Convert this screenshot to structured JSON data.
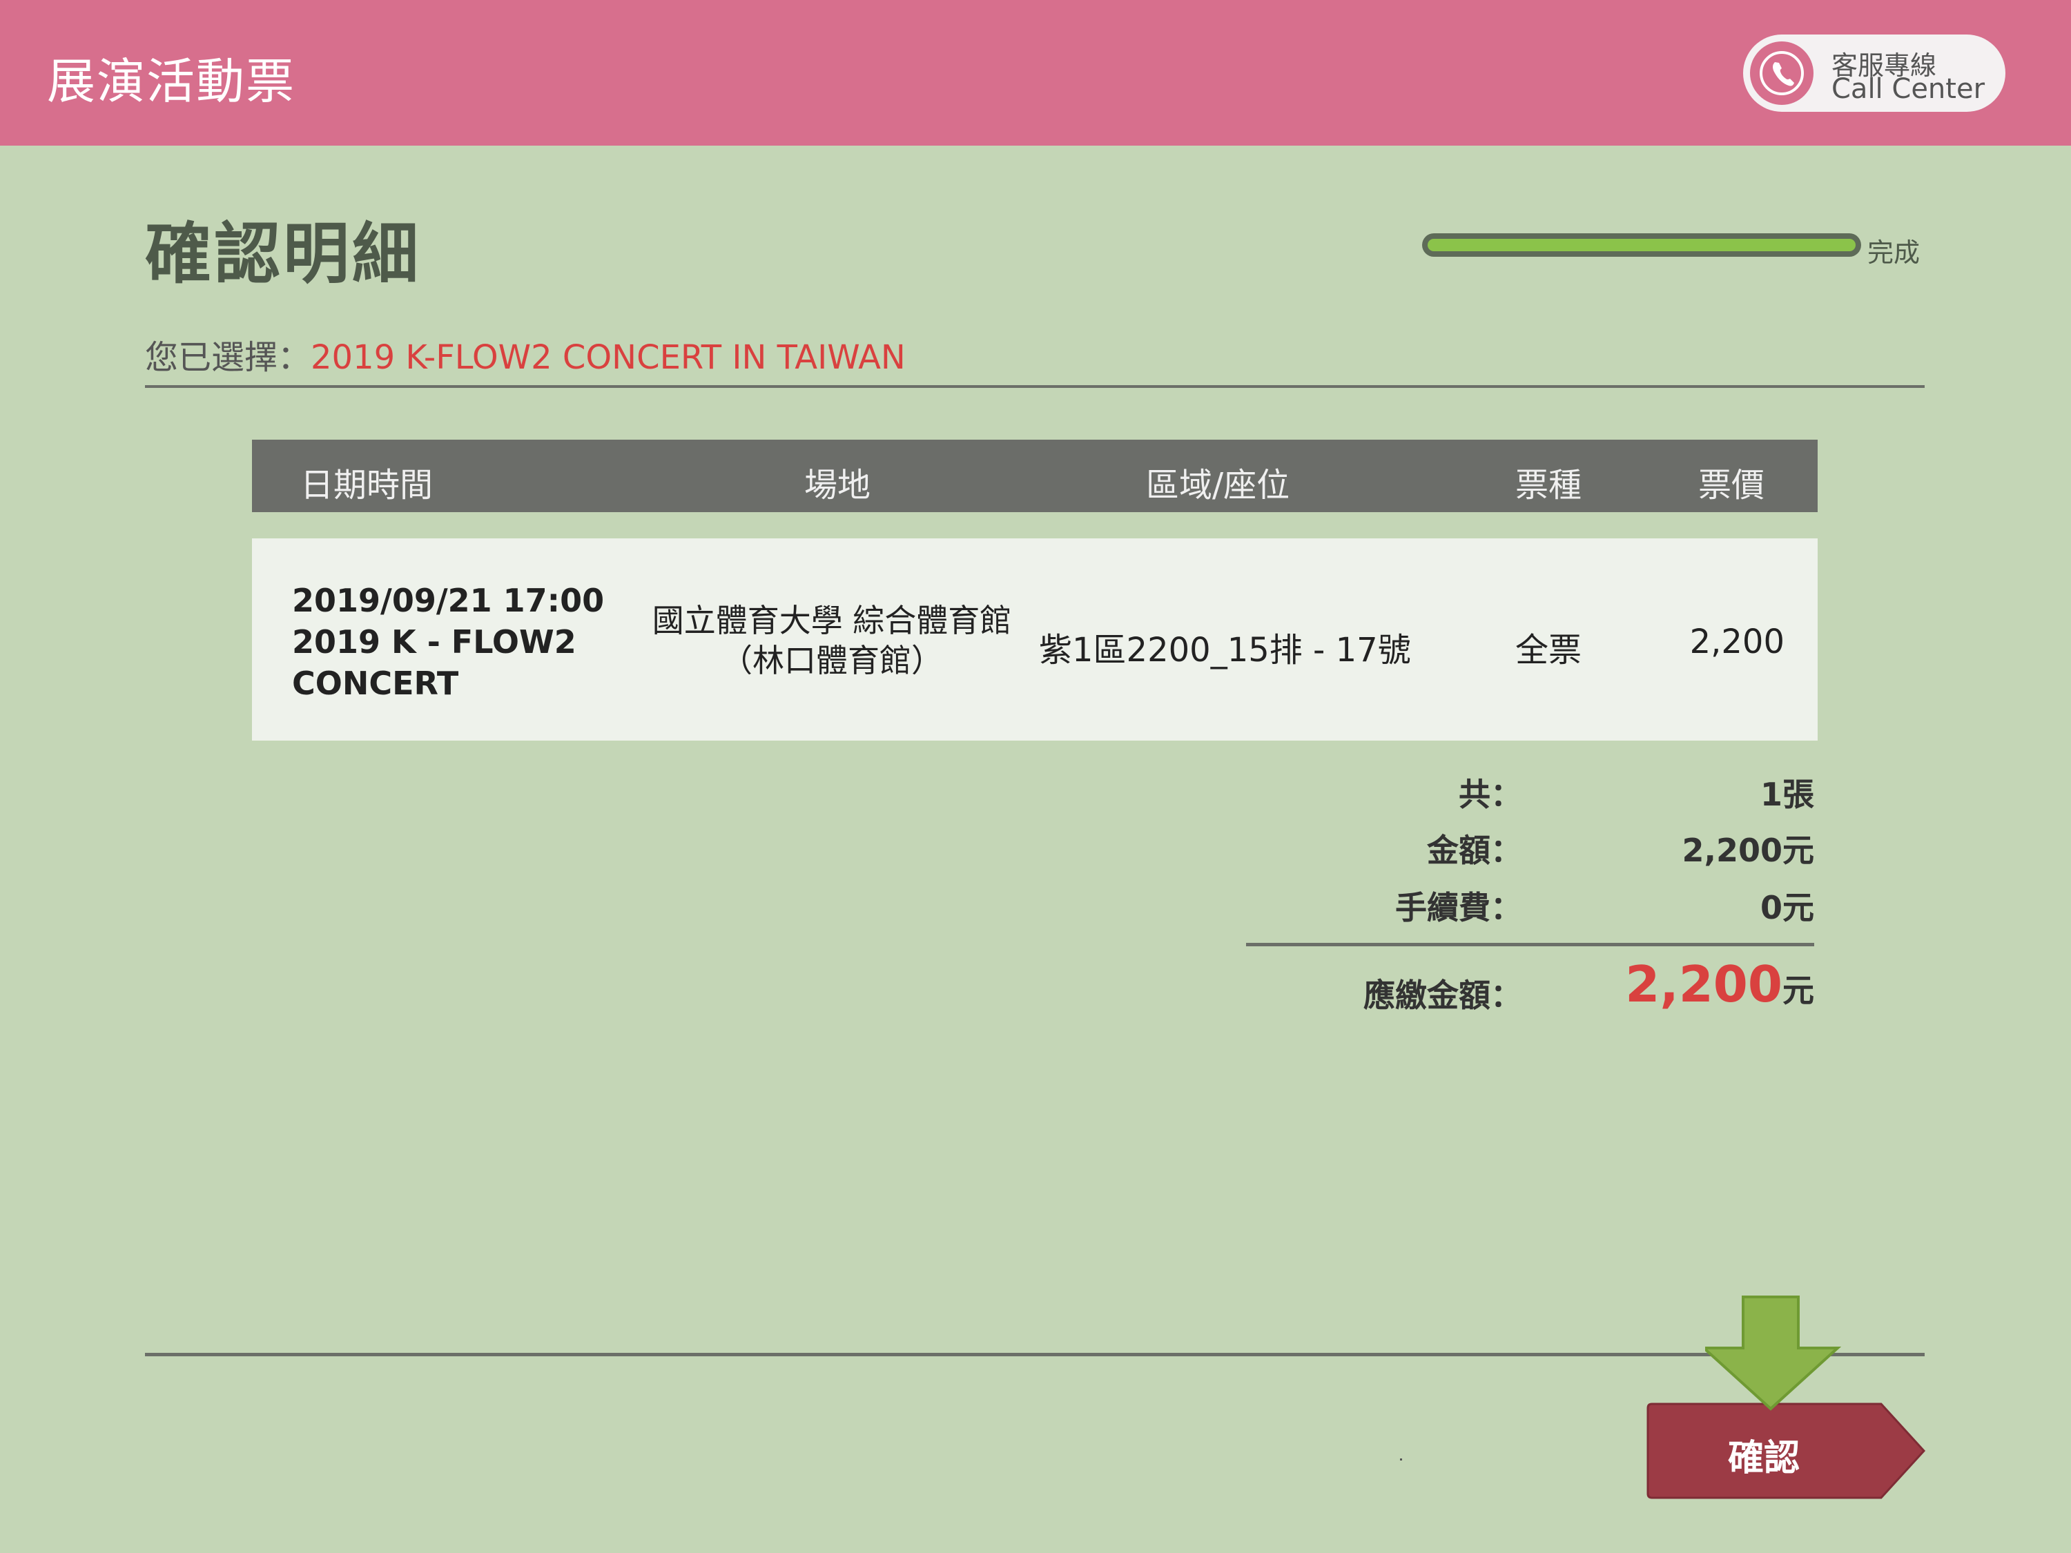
{
  "header": {
    "app_title": "展演活動票",
    "call_center_line1": "客服專線",
    "call_center_line2": "Call Center",
    "call_center_icon": "phone-icon"
  },
  "page": {
    "title": "確認明細",
    "progress_label": "完成",
    "progress_fraction": 1.0,
    "selected_label": "您已選擇：",
    "selected_event": "2019 K-FLOW2 CONCERT IN TAIWAN"
  },
  "table": {
    "headers": [
      "日期時間",
      "場地",
      "區域/座位",
      "票種",
      "票價"
    ],
    "rows": [
      {
        "datetime": "2019/09/21 17:00",
        "event_name": "2019 K - FLOW2 CONCERT",
        "venue": "國立體育大學 綜合體育館（林口體育館）",
        "seat": "紫1區2200_15排 - 17號",
        "ticket_type": "全票",
        "price": "2,200"
      }
    ]
  },
  "summary": {
    "count_label": "共：",
    "count_value": "1張",
    "amount_label": "金額：",
    "amount_value": "2,200元",
    "fee_label": "手續費：",
    "fee_value": "0元",
    "total_label": "應繳金額：",
    "total_value": "2,200",
    "total_unit": "元"
  },
  "actions": {
    "confirm_label": "確認",
    "hint_icon": "down-arrow-icon"
  },
  "colors": {
    "header_bg": "#d76f8d",
    "page_bg": "#c4d6b6",
    "accent_red": "#d9413f",
    "button_bg": "#9c3b45",
    "progress_green": "#8bc34a",
    "arrow_green": "#8bb34a"
  }
}
